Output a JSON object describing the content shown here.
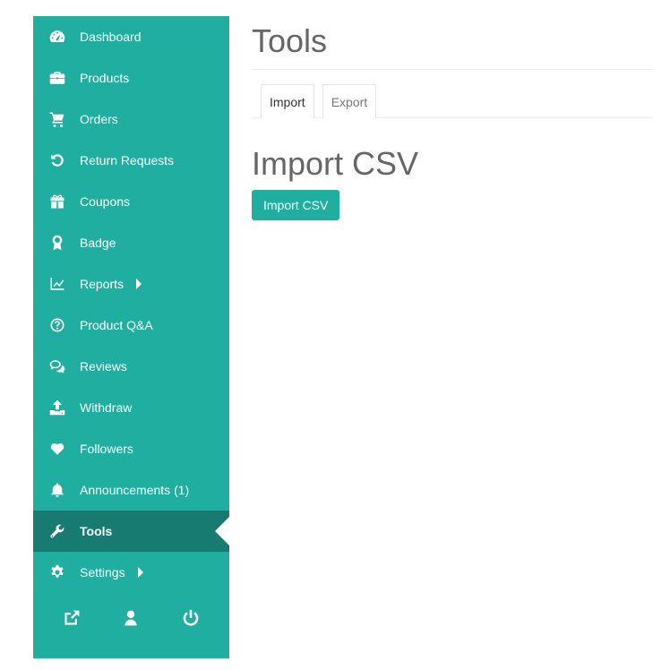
{
  "sidebar": {
    "items": [
      {
        "label": "Dashboard",
        "icon": "tachometer-icon"
      },
      {
        "label": "Products",
        "icon": "briefcase-icon"
      },
      {
        "label": "Orders",
        "icon": "shopping-cart-icon"
      },
      {
        "label": "Return Requests",
        "icon": "undo-icon"
      },
      {
        "label": "Coupons",
        "icon": "gift-icon"
      },
      {
        "label": "Badge",
        "icon": "award-icon"
      },
      {
        "label": "Reports",
        "icon": "line-chart-icon"
      },
      {
        "label": "Product Q&A",
        "icon": "question-circle-icon"
      },
      {
        "label": "Reviews",
        "icon": "comments-icon"
      },
      {
        "label": "Withdraw",
        "icon": "upload-icon"
      },
      {
        "label": "Followers",
        "icon": "heart-icon"
      },
      {
        "label": "Announcements (1)",
        "icon": "bell-icon"
      },
      {
        "label": "Tools",
        "icon": "wrench-icon"
      },
      {
        "label": "Settings",
        "icon": "gear-icon"
      }
    ],
    "footer": [
      "external-link-icon",
      "user-icon",
      "power-icon"
    ]
  },
  "main": {
    "title": "Tools",
    "tabs": [
      {
        "label": "Import"
      },
      {
        "label": "Export"
      }
    ],
    "section_title": "Import CSV",
    "button_label": "Import CSV"
  },
  "colors": {
    "sidebar_bg": "#1fae9f",
    "active_bg": "#177b72",
    "button_bg": "#1fae9f"
  }
}
